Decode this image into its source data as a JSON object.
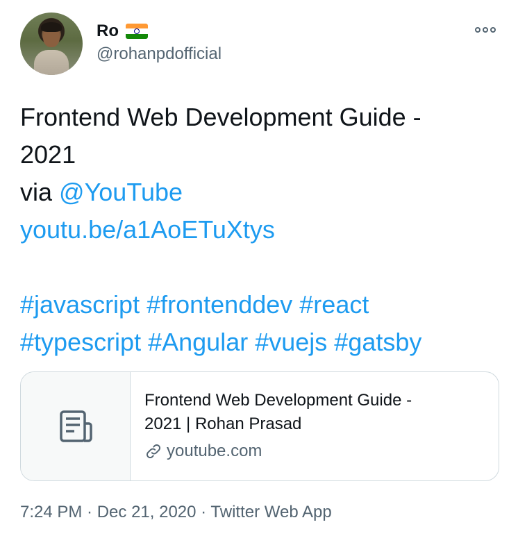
{
  "author": {
    "display_name": "Ro",
    "flag_icon": "india-flag-icon",
    "handle": "@rohanpdofficial"
  },
  "more_icon": "more-options-icon",
  "tweet": {
    "line1": "Frontend Web Development Guide -",
    "line2": "2021",
    "line3_prefix": "via ",
    "mention": "@YouTube",
    "link": "youtu.be/a1AoETuXtys",
    "hashtags_line1": [
      "#javascript",
      "#frontenddev",
      "#react"
    ],
    "hashtags_line2": [
      "#typescript",
      "#Angular",
      "#vuejs",
      "#gatsby"
    ]
  },
  "card": {
    "thumb_icon": "document-icon",
    "title_line1": "Frontend Web Development Guide -",
    "title_line2": "2021 | Rohan Prasad",
    "link_icon": "link-icon",
    "domain": "youtube.com"
  },
  "meta": {
    "time": "7:24 PM",
    "date": "Dec 21, 2020",
    "source": "Twitter Web App"
  },
  "colors": {
    "link": "#1d9bf0",
    "text": "#0f1419",
    "secondary": "#536471",
    "border": "#cfd9de"
  }
}
